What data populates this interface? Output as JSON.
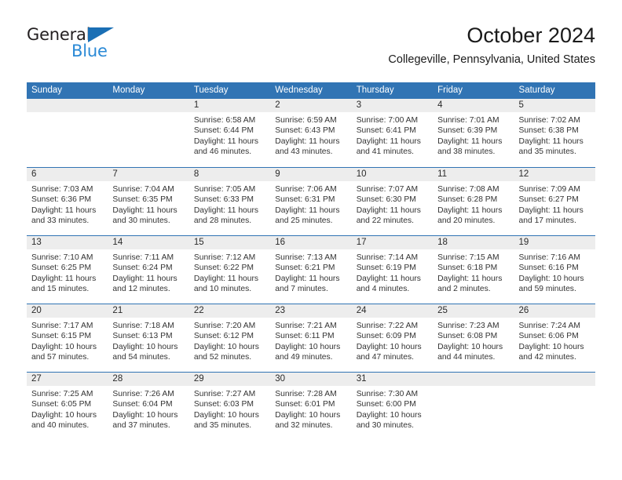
{
  "brand": {
    "name_part1": "General",
    "name_part2": "Blue",
    "accent_color": "#2b8ad6",
    "triangle_color": "#1a6fb5"
  },
  "header": {
    "title": "October 2024",
    "subtitle": "Collegeville, Pennsylvania, United States"
  },
  "theme": {
    "header_band": "#3174b4",
    "daynum_band": "#ededed",
    "cell_bg": "#ffffff",
    "text": "#333333"
  },
  "calendar": {
    "weekday_headers": [
      "Sunday",
      "Monday",
      "Tuesday",
      "Wednesday",
      "Thursday",
      "Friday",
      "Saturday"
    ],
    "weeks": [
      [
        {
          "day": "",
          "sunrise": "",
          "sunset": "",
          "daylight_line1": "",
          "daylight_line2": "",
          "empty": true
        },
        {
          "day": "",
          "sunrise": "",
          "sunset": "",
          "daylight_line1": "",
          "daylight_line2": "",
          "empty": true
        },
        {
          "day": "1",
          "sunrise": "Sunrise: 6:58 AM",
          "sunset": "Sunset: 6:44 PM",
          "daylight_line1": "Daylight: 11 hours",
          "daylight_line2": "and 46 minutes."
        },
        {
          "day": "2",
          "sunrise": "Sunrise: 6:59 AM",
          "sunset": "Sunset: 6:43 PM",
          "daylight_line1": "Daylight: 11 hours",
          "daylight_line2": "and 43 minutes."
        },
        {
          "day": "3",
          "sunrise": "Sunrise: 7:00 AM",
          "sunset": "Sunset: 6:41 PM",
          "daylight_line1": "Daylight: 11 hours",
          "daylight_line2": "and 41 minutes."
        },
        {
          "day": "4",
          "sunrise": "Sunrise: 7:01 AM",
          "sunset": "Sunset: 6:39 PM",
          "daylight_line1": "Daylight: 11 hours",
          "daylight_line2": "and 38 minutes."
        },
        {
          "day": "5",
          "sunrise": "Sunrise: 7:02 AM",
          "sunset": "Sunset: 6:38 PM",
          "daylight_line1": "Daylight: 11 hours",
          "daylight_line2": "and 35 minutes."
        }
      ],
      [
        {
          "day": "6",
          "sunrise": "Sunrise: 7:03 AM",
          "sunset": "Sunset: 6:36 PM",
          "daylight_line1": "Daylight: 11 hours",
          "daylight_line2": "and 33 minutes."
        },
        {
          "day": "7",
          "sunrise": "Sunrise: 7:04 AM",
          "sunset": "Sunset: 6:35 PM",
          "daylight_line1": "Daylight: 11 hours",
          "daylight_line2": "and 30 minutes."
        },
        {
          "day": "8",
          "sunrise": "Sunrise: 7:05 AM",
          "sunset": "Sunset: 6:33 PM",
          "daylight_line1": "Daylight: 11 hours",
          "daylight_line2": "and 28 minutes."
        },
        {
          "day": "9",
          "sunrise": "Sunrise: 7:06 AM",
          "sunset": "Sunset: 6:31 PM",
          "daylight_line1": "Daylight: 11 hours",
          "daylight_line2": "and 25 minutes."
        },
        {
          "day": "10",
          "sunrise": "Sunrise: 7:07 AM",
          "sunset": "Sunset: 6:30 PM",
          "daylight_line1": "Daylight: 11 hours",
          "daylight_line2": "and 22 minutes."
        },
        {
          "day": "11",
          "sunrise": "Sunrise: 7:08 AM",
          "sunset": "Sunset: 6:28 PM",
          "daylight_line1": "Daylight: 11 hours",
          "daylight_line2": "and 20 minutes."
        },
        {
          "day": "12",
          "sunrise": "Sunrise: 7:09 AM",
          "sunset": "Sunset: 6:27 PM",
          "daylight_line1": "Daylight: 11 hours",
          "daylight_line2": "and 17 minutes."
        }
      ],
      [
        {
          "day": "13",
          "sunrise": "Sunrise: 7:10 AM",
          "sunset": "Sunset: 6:25 PM",
          "daylight_line1": "Daylight: 11 hours",
          "daylight_line2": "and 15 minutes."
        },
        {
          "day": "14",
          "sunrise": "Sunrise: 7:11 AM",
          "sunset": "Sunset: 6:24 PM",
          "daylight_line1": "Daylight: 11 hours",
          "daylight_line2": "and 12 minutes."
        },
        {
          "day": "15",
          "sunrise": "Sunrise: 7:12 AM",
          "sunset": "Sunset: 6:22 PM",
          "daylight_line1": "Daylight: 11 hours",
          "daylight_line2": "and 10 minutes."
        },
        {
          "day": "16",
          "sunrise": "Sunrise: 7:13 AM",
          "sunset": "Sunset: 6:21 PM",
          "daylight_line1": "Daylight: 11 hours",
          "daylight_line2": "and 7 minutes."
        },
        {
          "day": "17",
          "sunrise": "Sunrise: 7:14 AM",
          "sunset": "Sunset: 6:19 PM",
          "daylight_line1": "Daylight: 11 hours",
          "daylight_line2": "and 4 minutes."
        },
        {
          "day": "18",
          "sunrise": "Sunrise: 7:15 AM",
          "sunset": "Sunset: 6:18 PM",
          "daylight_line1": "Daylight: 11 hours",
          "daylight_line2": "and 2 minutes."
        },
        {
          "day": "19",
          "sunrise": "Sunrise: 7:16 AM",
          "sunset": "Sunset: 6:16 PM",
          "daylight_line1": "Daylight: 10 hours",
          "daylight_line2": "and 59 minutes."
        }
      ],
      [
        {
          "day": "20",
          "sunrise": "Sunrise: 7:17 AM",
          "sunset": "Sunset: 6:15 PM",
          "daylight_line1": "Daylight: 10 hours",
          "daylight_line2": "and 57 minutes."
        },
        {
          "day": "21",
          "sunrise": "Sunrise: 7:18 AM",
          "sunset": "Sunset: 6:13 PM",
          "daylight_line1": "Daylight: 10 hours",
          "daylight_line2": "and 54 minutes."
        },
        {
          "day": "22",
          "sunrise": "Sunrise: 7:20 AM",
          "sunset": "Sunset: 6:12 PM",
          "daylight_line1": "Daylight: 10 hours",
          "daylight_line2": "and 52 minutes."
        },
        {
          "day": "23",
          "sunrise": "Sunrise: 7:21 AM",
          "sunset": "Sunset: 6:11 PM",
          "daylight_line1": "Daylight: 10 hours",
          "daylight_line2": "and 49 minutes."
        },
        {
          "day": "24",
          "sunrise": "Sunrise: 7:22 AM",
          "sunset": "Sunset: 6:09 PM",
          "daylight_line1": "Daylight: 10 hours",
          "daylight_line2": "and 47 minutes."
        },
        {
          "day": "25",
          "sunrise": "Sunrise: 7:23 AM",
          "sunset": "Sunset: 6:08 PM",
          "daylight_line1": "Daylight: 10 hours",
          "daylight_line2": "and 44 minutes."
        },
        {
          "day": "26",
          "sunrise": "Sunrise: 7:24 AM",
          "sunset": "Sunset: 6:06 PM",
          "daylight_line1": "Daylight: 10 hours",
          "daylight_line2": "and 42 minutes."
        }
      ],
      [
        {
          "day": "27",
          "sunrise": "Sunrise: 7:25 AM",
          "sunset": "Sunset: 6:05 PM",
          "daylight_line1": "Daylight: 10 hours",
          "daylight_line2": "and 40 minutes."
        },
        {
          "day": "28",
          "sunrise": "Sunrise: 7:26 AM",
          "sunset": "Sunset: 6:04 PM",
          "daylight_line1": "Daylight: 10 hours",
          "daylight_line2": "and 37 minutes."
        },
        {
          "day": "29",
          "sunrise": "Sunrise: 7:27 AM",
          "sunset": "Sunset: 6:03 PM",
          "daylight_line1": "Daylight: 10 hours",
          "daylight_line2": "and 35 minutes."
        },
        {
          "day": "30",
          "sunrise": "Sunrise: 7:28 AM",
          "sunset": "Sunset: 6:01 PM",
          "daylight_line1": "Daylight: 10 hours",
          "daylight_line2": "and 32 minutes."
        },
        {
          "day": "31",
          "sunrise": "Sunrise: 7:30 AM",
          "sunset": "Sunset: 6:00 PM",
          "daylight_line1": "Daylight: 10 hours",
          "daylight_line2": "and 30 minutes."
        },
        {
          "day": "",
          "sunrise": "",
          "sunset": "",
          "daylight_line1": "",
          "daylight_line2": "",
          "empty": true
        },
        {
          "day": "",
          "sunrise": "",
          "sunset": "",
          "daylight_line1": "",
          "daylight_line2": "",
          "empty": true
        }
      ]
    ]
  }
}
